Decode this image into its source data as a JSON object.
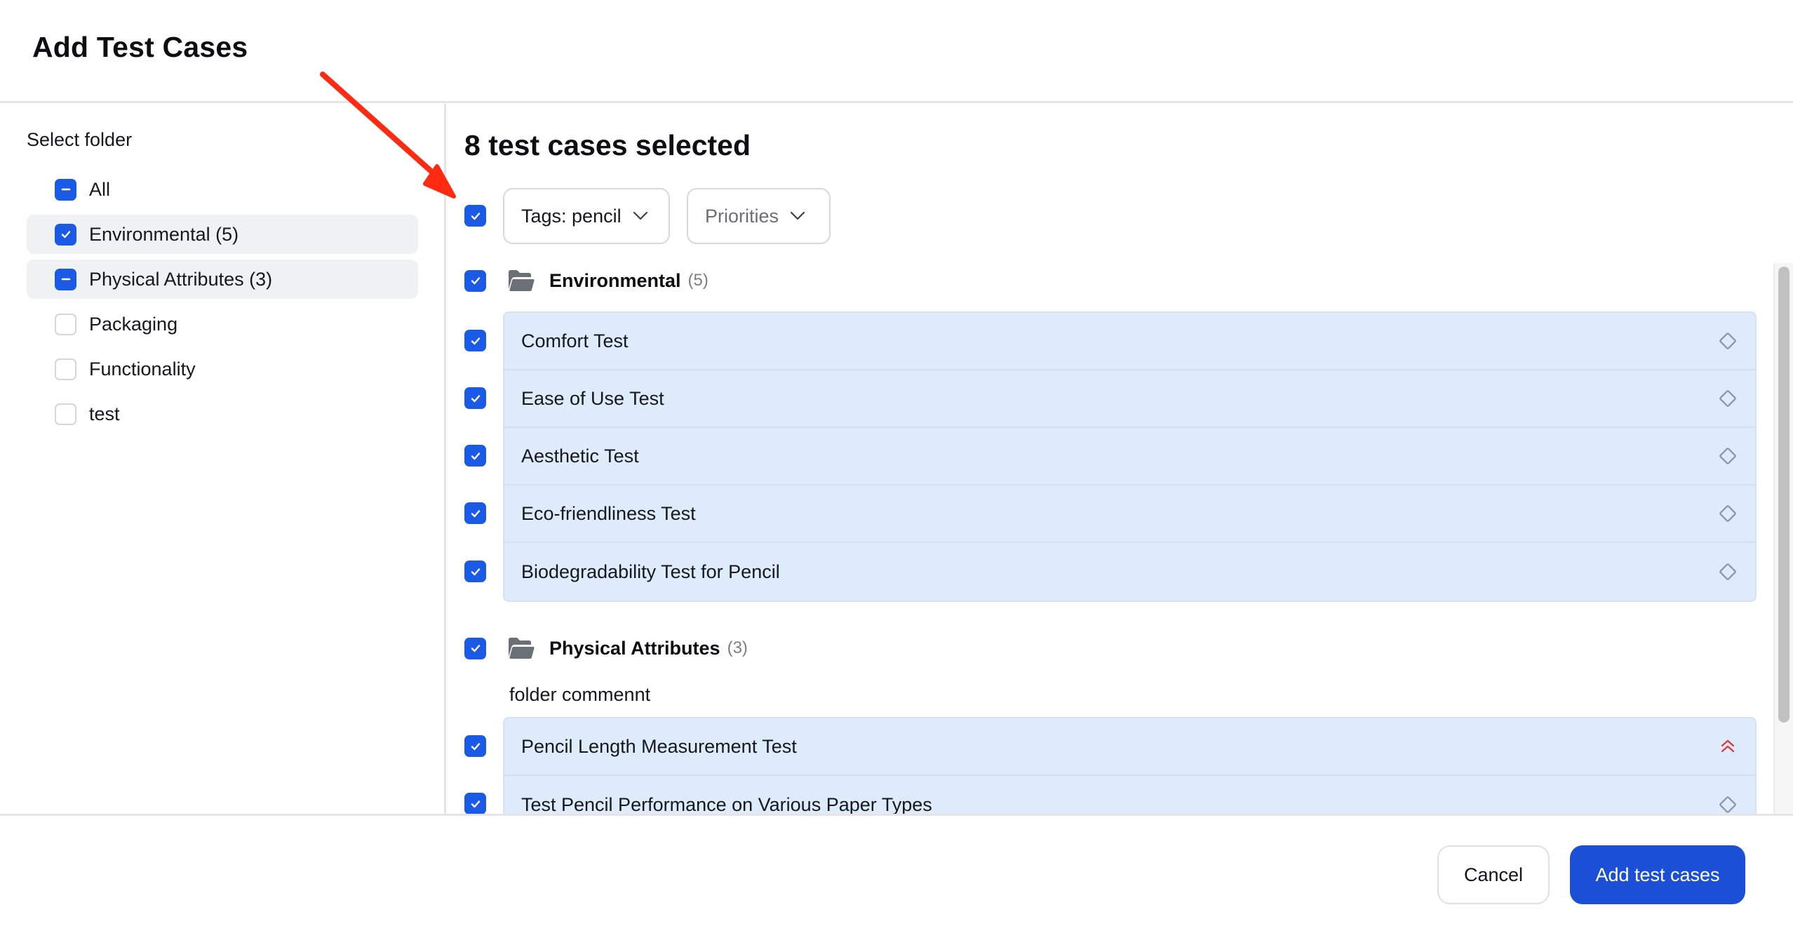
{
  "dialog": {
    "title": "Add Test Cases"
  },
  "sidebar": {
    "label": "Select folder",
    "folders": [
      {
        "label": "All",
        "state": "indeterminate",
        "highlighted": false
      },
      {
        "label": "Environmental (5)",
        "state": "checked",
        "highlighted": true
      },
      {
        "label": "Physical Attributes (3)",
        "state": "indeterminate",
        "highlighted": true
      },
      {
        "label": "Packaging",
        "state": "unchecked",
        "highlighted": false
      },
      {
        "label": "Functionality",
        "state": "unchecked",
        "highlighted": false
      },
      {
        "label": "test",
        "state": "unchecked",
        "highlighted": false
      }
    ]
  },
  "main": {
    "selected_count_label": "8 test cases selected",
    "select_all_state": "checked",
    "filters": {
      "tags_label": "Tags: pencil",
      "priorities_label": "Priorities"
    },
    "groups": [
      {
        "name": "Environmental",
        "count": "(5)",
        "state": "checked",
        "comment": "",
        "cases": [
          {
            "title": "Comfort Test",
            "priority": "none",
            "checked": true
          },
          {
            "title": "Ease of Use Test",
            "priority": "none",
            "checked": true
          },
          {
            "title": "Aesthetic Test",
            "priority": "none",
            "checked": true
          },
          {
            "title": "Eco-friendliness Test",
            "priority": "none",
            "checked": true
          },
          {
            "title": "Biodegradability Test for Pencil",
            "priority": "none",
            "checked": true
          }
        ]
      },
      {
        "name": "Physical Attributes",
        "count": "(3)",
        "state": "checked",
        "comment": "folder commennt",
        "cases": [
          {
            "title": "Pencil Length Measurement Test",
            "priority": "high",
            "checked": true
          },
          {
            "title": "Test Pencil Performance on Various Paper Types",
            "priority": "none",
            "checked": true
          }
        ]
      }
    ]
  },
  "footer": {
    "cancel_label": "Cancel",
    "submit_label": "Add test cases"
  },
  "colors": {
    "accent": "#1a5ae6",
    "primary_button": "#1b4fd6",
    "case_row_bg": "#ddebfb",
    "priority_high": "#e0393e",
    "priority_none": "#8a94a3",
    "annotation_arrow": "#ff2a12"
  }
}
